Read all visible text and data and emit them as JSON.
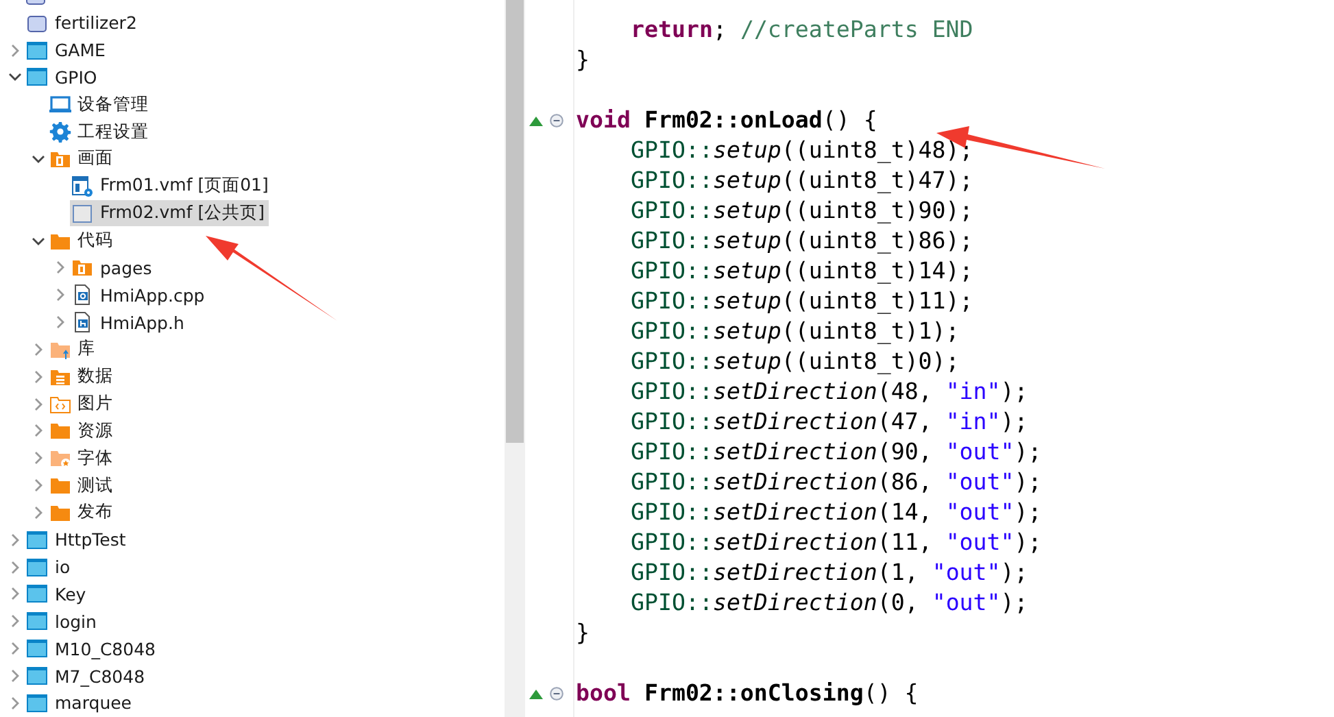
{
  "tree": [
    {
      "kind": "project_light"
    },
    {
      "label": "fertilizer2",
      "kind": "project_light"
    },
    {
      "label": "GAME",
      "kind": "project",
      "expanded": false
    },
    {
      "label": "GPIO",
      "kind": "project",
      "expanded": true,
      "children": [
        {
          "label": "设备管理",
          "kind": "device"
        },
        {
          "label": "工程设置",
          "kind": "gear"
        },
        {
          "label": "画面",
          "kind": "page_folder",
          "expanded": true,
          "children": [
            {
              "label": "Frm01.vmf [页面01]",
              "kind": "form",
              "selected": false
            },
            {
              "label": "Frm02.vmf [公共页]",
              "kind": "blank_form",
              "selected": true
            }
          ]
        },
        {
          "label": "代码",
          "kind": "folder",
          "expanded": true,
          "children": [
            {
              "label": "pages",
              "kind": "page_folder",
              "expanded": false
            },
            {
              "label": "HmiApp.cpp",
              "kind": "file_c",
              "expanded": false
            },
            {
              "label": "HmiApp.h",
              "kind": "file_h",
              "expanded": false
            }
          ]
        },
        {
          "label": "库",
          "kind": "lib_folder",
          "expanded": false
        },
        {
          "label": "数据",
          "kind": "data_folder",
          "expanded": false
        },
        {
          "label": "图片",
          "kind": "image_folder",
          "expanded": false
        },
        {
          "label": "资源",
          "kind": "folder",
          "expanded": false
        },
        {
          "label": "字体",
          "kind": "font_folder",
          "expanded": false
        },
        {
          "label": "测试",
          "kind": "folder",
          "expanded": false
        },
        {
          "label": "发布",
          "kind": "folder",
          "expanded": false
        }
      ]
    },
    {
      "label": "HttpTest",
      "kind": "project",
      "expanded": false
    },
    {
      "label": "io",
      "kind": "project",
      "expanded": false
    },
    {
      "label": "Key",
      "kind": "project",
      "expanded": false
    },
    {
      "label": "login",
      "kind": "project",
      "expanded": false
    },
    {
      "label": "M10_C8048",
      "kind": "project",
      "expanded": false
    },
    {
      "label": "M7_C8048",
      "kind": "project",
      "expanded": false
    },
    {
      "label": "marquee",
      "kind": "project",
      "expanded": false
    }
  ],
  "code": [
    {
      "children": [
        {
          "tokens": [
            {
              "kind": "keyword",
              "t": "return"
            },
            {
              "kind": "plain",
              "t": ";"
            },
            {
              "kind": "comment",
              "t": "//createParts END"
            }
          ]
        }
      ],
      "end": "}"
    },
    {
      "fold": true,
      "tokens": [
        {
          "kind": "keyword",
          "t": "void"
        },
        {
          "kind": "name",
          "t": "Frm02::onLoad"
        },
        {
          "kind": "plain",
          "t": "() {"
        }
      ],
      "children": [
        {
          "tokens": [
            {
              "kind": "class",
              "t": "GPIO::"
            },
            {
              "kind": "method",
              "t": "setup"
            },
            {
              "kind": "plain",
              "t": "((uint8_t)48);"
            }
          ]
        },
        {
          "tokens": [
            {
              "kind": "class",
              "t": "GPIO::"
            },
            {
              "kind": "method",
              "t": "setup"
            },
            {
              "kind": "plain",
              "t": "((uint8_t)47);"
            }
          ]
        },
        {
          "tokens": [
            {
              "kind": "class",
              "t": "GPIO::"
            },
            {
              "kind": "method",
              "t": "setup"
            },
            {
              "kind": "plain",
              "t": "((uint8_t)90);"
            }
          ]
        },
        {
          "tokens": [
            {
              "kind": "class",
              "t": "GPIO::"
            },
            {
              "kind": "method",
              "t": "setup"
            },
            {
              "kind": "plain",
              "t": "((uint8_t)86);"
            }
          ]
        },
        {
          "tokens": [
            {
              "kind": "class",
              "t": "GPIO::"
            },
            {
              "kind": "method",
              "t": "setup"
            },
            {
              "kind": "plain",
              "t": "((uint8_t)14);"
            }
          ]
        },
        {
          "tokens": [
            {
              "kind": "class",
              "t": "GPIO::"
            },
            {
              "kind": "method",
              "t": "setup"
            },
            {
              "kind": "plain",
              "t": "((uint8_t)11);"
            }
          ]
        },
        {
          "tokens": [
            {
              "kind": "class",
              "t": "GPIO::"
            },
            {
              "kind": "method",
              "t": "setup"
            },
            {
              "kind": "plain",
              "t": "((uint8_t)1);"
            }
          ]
        },
        {
          "tokens": [
            {
              "kind": "class",
              "t": "GPIO::"
            },
            {
              "kind": "method",
              "t": "setup"
            },
            {
              "kind": "plain",
              "t": "((uint8_t)0);"
            }
          ]
        },
        {
          "tokens": [
            {
              "kind": "class",
              "t": "GPIO::"
            },
            {
              "kind": "method",
              "t": "setDirection"
            },
            {
              "kind": "plain",
              "t": "(48,"
            },
            {
              "kind": "string",
              "t": "\"in\""
            },
            {
              "kind": "plain",
              "t": ");"
            }
          ]
        },
        {
          "tokens": [
            {
              "kind": "class",
              "t": "GPIO::"
            },
            {
              "kind": "method",
              "t": "setDirection"
            },
            {
              "kind": "plain",
              "t": "(47,"
            },
            {
              "kind": "string",
              "t": "\"in\""
            },
            {
              "kind": "plain",
              "t": ");"
            }
          ]
        },
        {
          "tokens": [
            {
              "kind": "class",
              "t": "GPIO::"
            },
            {
              "kind": "method",
              "t": "setDirection"
            },
            {
              "kind": "plain",
              "t": "(90,"
            },
            {
              "kind": "string",
              "t": "\"out\""
            },
            {
              "kind": "plain",
              "t": ");"
            }
          ]
        },
        {
          "tokens": [
            {
              "kind": "class",
              "t": "GPIO::"
            },
            {
              "kind": "method",
              "t": "setDirection"
            },
            {
              "kind": "plain",
              "t": "(86,"
            },
            {
              "kind": "string",
              "t": "\"out\""
            },
            {
              "kind": "plain",
              "t": ");"
            }
          ]
        },
        {
          "tokens": [
            {
              "kind": "class",
              "t": "GPIO::"
            },
            {
              "kind": "method",
              "t": "setDirection"
            },
            {
              "kind": "plain",
              "t": "(14,"
            },
            {
              "kind": "string",
              "t": "\"out\""
            },
            {
              "kind": "plain",
              "t": ");"
            }
          ]
        },
        {
          "tokens": [
            {
              "kind": "class",
              "t": "GPIO::"
            },
            {
              "kind": "method",
              "t": "setDirection"
            },
            {
              "kind": "plain",
              "t": "(11,"
            },
            {
              "kind": "string",
              "t": "\"out\""
            },
            {
              "kind": "plain",
              "t": ");"
            }
          ]
        },
        {
          "tokens": [
            {
              "kind": "class",
              "t": "GPIO::"
            },
            {
              "kind": "method",
              "t": "setDirection"
            },
            {
              "kind": "plain",
              "t": "(1,"
            },
            {
              "kind": "string",
              "t": "\"out\""
            },
            {
              "kind": "plain",
              "t": ");"
            }
          ]
        },
        {
          "tokens": [
            {
              "kind": "class",
              "t": "GPIO::"
            },
            {
              "kind": "method",
              "t": "setDirection"
            },
            {
              "kind": "plain",
              "t": "(0,"
            },
            {
              "kind": "string",
              "t": "\"out\""
            },
            {
              "kind": "plain",
              "t": ");"
            }
          ]
        }
      ],
      "end": "}"
    },
    {
      "fold": true,
      "tokens": [
        {
          "kind": "keyword",
          "t": "bool"
        },
        {
          "kind": "name",
          "t": "Frm02::onClosing"
        },
        {
          "kind": "plain",
          "t": "() {"
        }
      ]
    }
  ]
}
